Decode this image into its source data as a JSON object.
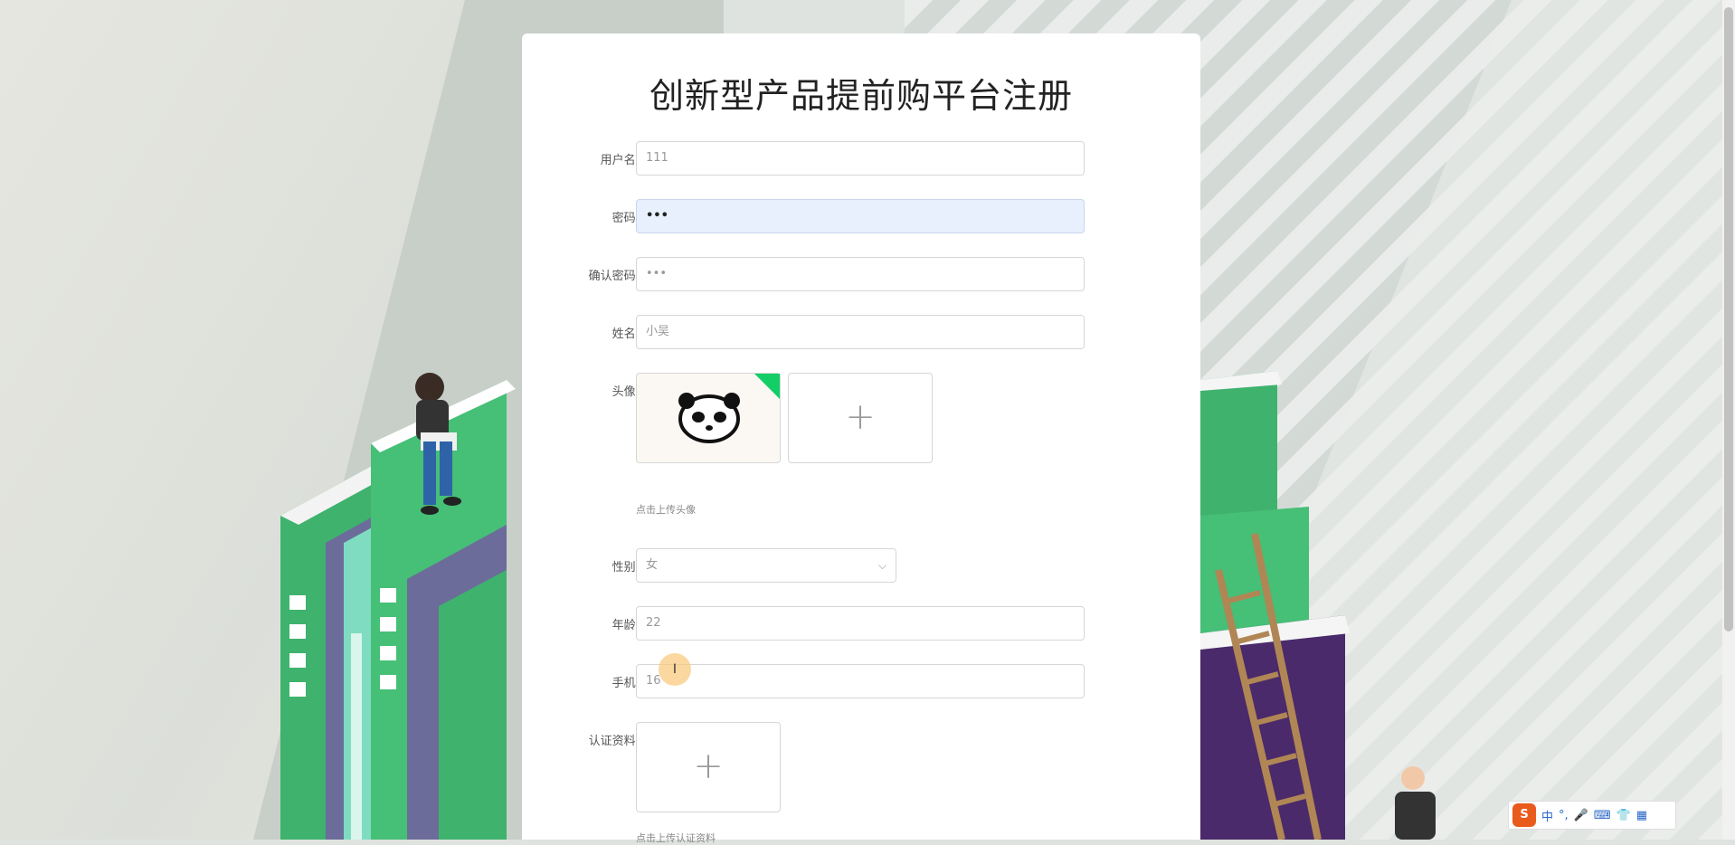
{
  "title": "创新型产品提前购平台注册",
  "form": {
    "username": {
      "label": "用户名:",
      "value": "111"
    },
    "password": {
      "label": "密码:",
      "value": "•••"
    },
    "confirm_password": {
      "label": "确认密码:",
      "value": "•••"
    },
    "name": {
      "label": "姓名:",
      "value": "小吴"
    },
    "avatar": {
      "label": "头像:",
      "hint": "点击上传头像",
      "add_symbol": "+"
    },
    "gender": {
      "label": "性别:",
      "value": "女"
    },
    "age": {
      "label": "年龄:",
      "value": "22"
    },
    "phone": {
      "label": "手机:",
      "value": "16"
    },
    "certification": {
      "label": "认证资料:",
      "hint": "点击上传认证资料",
      "add_symbol": "+"
    }
  },
  "ime": {
    "items": [
      "中",
      "°,",
      "🎤",
      "⌨",
      "👕",
      "▦"
    ]
  },
  "colors": {
    "success_corner": "#13ce66",
    "focus_bg": "#e8f0fe"
  }
}
